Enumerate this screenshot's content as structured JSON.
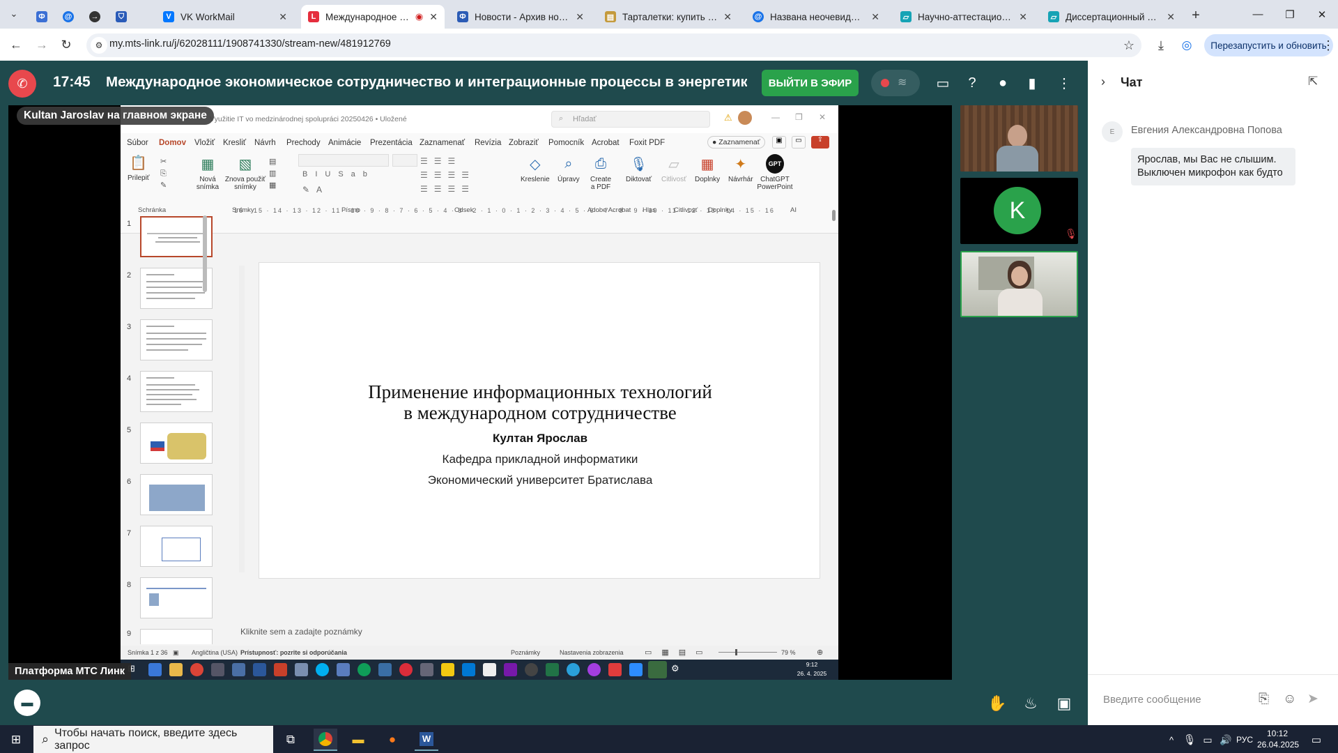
{
  "browser": {
    "tabs": [
      {
        "title": "",
        "icon": "vk-icon"
      },
      {
        "title": "",
        "icon": "mail-at-icon"
      },
      {
        "title": "",
        "icon": "arrow-circle-icon"
      },
      {
        "title": "",
        "icon": "shield-icon"
      },
      {
        "title": "VK WorkMail",
        "icon": "vk-icon"
      },
      {
        "title": "Международное эконо",
        "icon": "mts-link-icon",
        "active": true,
        "recording": true
      },
      {
        "title": "Новости - Архив новостей",
        "icon": "phi-icon"
      },
      {
        "title": "Тарталетки: купить с доставкой",
        "icon": "bookmark-icon"
      },
      {
        "title": "Названа неочевидная ошибка",
        "icon": "mail-at-icon"
      },
      {
        "title": "Научно-аттестационная",
        "icon": "doc-icon"
      },
      {
        "title": "Диссертационный совет",
        "icon": "doc-icon"
      }
    ],
    "url": "my.mts-link.ru/j/62028111/1908741330/stream-new/481912769",
    "relaunch_label": "Перезапустить и обновить"
  },
  "meeting": {
    "time": "17:45",
    "title": "Международное экономическое сотрудничество и интеграционные процессы в энергетике (Л",
    "go_live_label": "ВЫЙТИ В ЭФИР",
    "share_label": "Kultan Jaroslav на главном экране",
    "platform_label": "Платформа МТС Линк",
    "participant_initial": "K"
  },
  "ppt": {
    "file_title": "Využitie IT vo medzinárodnej spolupráci 20250426 • Uložené",
    "search_placeholder": "Hľadať",
    "tabs": [
      "Súbor",
      "Domov",
      "Vložiť",
      "Kresliť",
      "Návrh",
      "Prechody",
      "Animácie",
      "Prezentácia",
      "Zaznamenať",
      "Revízia",
      "Zobraziť",
      "Pomocník",
      "Acrobat",
      "Foxit PDF"
    ],
    "record_label": "Zaznamenať",
    "buttons": [
      "Prilepiť",
      "Nová snímka",
      "Znova použiť snímky",
      "Kreslenie",
      "Úpravy",
      "Create a PDF",
      "Diktovať",
      "Citlivosť",
      "Doplnky",
      "Návrhár",
      "ChatGPT PowerPoint"
    ],
    "groups": [
      "Schránka",
      "Snímky",
      "Písmo",
      "Odsek",
      "Adobe Acrobat",
      "Hlas",
      "Citlivosť",
      "Doplnky",
      "AI"
    ],
    "slide_numbers": [
      "1",
      "2",
      "3",
      "4",
      "5",
      "6",
      "7",
      "8",
      "9"
    ],
    "ruler": "16 · 15 · 14 · 13 · 12 · 11 · 10 · 9 · 8 · 7 · 6 · 5 · 4 · 3 · 2 · 1 · 0 · 1 · 2 · 3 · 4 · 5 · 6 · 7 · 8 · 9 · 10 · 11 · 12 · 13 · 14 · 15 · 16",
    "slide": {
      "title_line1": "Применение информационных технологий",
      "title_line2": "в международном сотрудничестве",
      "author": "Култан Ярослав",
      "department": "Кафедра прикладной информатики",
      "university": "Экономический университет Братислава"
    },
    "notes_placeholder": "Kliknite sem a zadajte poznámky",
    "status": {
      "slide_count": "Snímka 1 z 36",
      "language": "Angličtina (USA)",
      "accessibility": "Prístupnosť: pozrite si odporúčania",
      "notes": "Poznámky",
      "view_settings": "Nastavenia zobrazenia",
      "zoom": "79 %"
    },
    "remote_clock_time": "9:12",
    "remote_clock_date": "26. 4. 2025"
  },
  "chat": {
    "title": "Чат",
    "message_author_initial": "Е",
    "message_author": "Евгения Александровна Попова",
    "message_text": "Ярослав, мы Вас не слышим. Выключен микрофон как будто",
    "input_placeholder": "Введите сообщение"
  },
  "taskbar": {
    "search_placeholder": "Чтобы начать поиск, введите здесь запрос",
    "lang": "РУС",
    "time": "10:12",
    "date": "26.04.2025"
  }
}
